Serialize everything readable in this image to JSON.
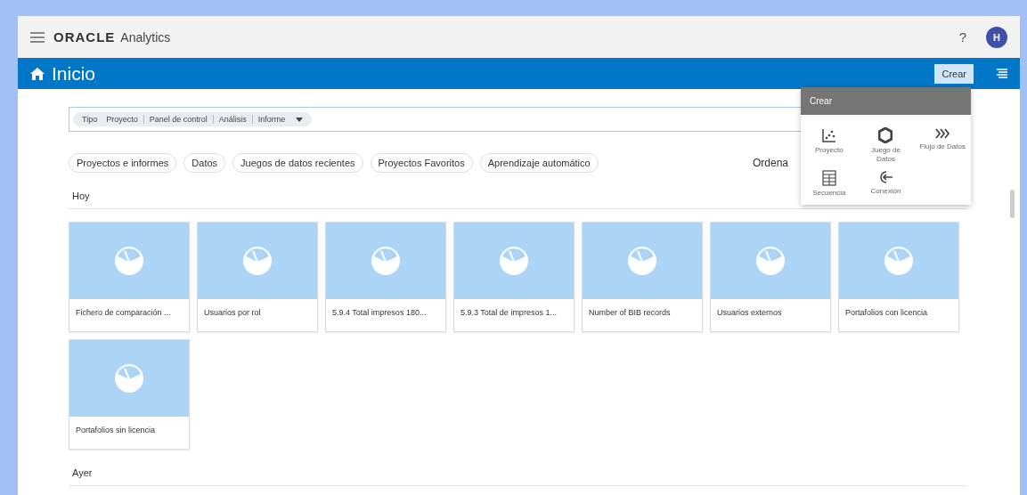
{
  "header": {
    "brand": "ORACLE",
    "product": "Analytics",
    "help": "?",
    "avatar": "H"
  },
  "title_bar": {
    "title": "Inicio",
    "create_button": {
      "label": "Crear",
      "expanded": true
    }
  },
  "filter": {
    "label": "Tipo",
    "options": [
      "Proyecto",
      "Panel de control",
      "Análisis",
      "Informe"
    ]
  },
  "chips": [
    "Proyectos e informes",
    "Datos",
    "Juegos de datos recientes",
    "Proyectos Favoritos",
    "Aprendizaje automático"
  ],
  "sort_label": "Ordena",
  "sections": [
    {
      "title": "Hoy",
      "cards": [
        {
          "title": "Fichero de comparación ..."
        },
        {
          "title": "Usuarios por rol"
        },
        {
          "title": "5.9.4 Total impresos 180..."
        },
        {
          "title": "5.9.3 Total de impresos 1..."
        },
        {
          "title": "Number of BIB records"
        },
        {
          "title": "Usuarios externos"
        },
        {
          "title": "Portafolios con licencia"
        },
        {
          "title": "Portafolios sin licencia"
        }
      ]
    },
    {
      "title": "Ayer"
    }
  ],
  "create_menu": {
    "title": "Crear",
    "items": [
      {
        "kind": "project",
        "label": "Proyecto"
      },
      {
        "kind": "dataset",
        "label": "Juego de Datos"
      },
      {
        "kind": "dataflow",
        "label": "Flujo de Datos"
      },
      {
        "kind": "sequence",
        "label": "Secuencia"
      },
      {
        "kind": "connection",
        "label": "Conexión"
      }
    ]
  }
}
